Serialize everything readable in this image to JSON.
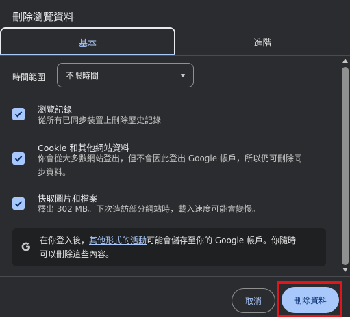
{
  "dialog": {
    "title": "刪除瀏覽資料"
  },
  "tabs": [
    {
      "label": "基本",
      "selected": true
    },
    {
      "label": "進階",
      "selected": false
    }
  ],
  "time_range": {
    "label": "時間範圍",
    "selected": "不限時間"
  },
  "options": [
    {
      "title": "瀏覽記錄",
      "description": "從所有已同步裝置上刪除歷史記錄",
      "checked": true
    },
    {
      "title": "Cookie 和其他網站資料",
      "description_line1": "你會從大多數網站登出，但不會因此登出 Google 帳戶，所以仍可刪除同",
      "description_line2": "步資料。",
      "checked": true
    },
    {
      "title": "快取圖片和檔案",
      "description": "釋出 302 MB。下次造訪部分網站時，載入速度可能會變慢。",
      "checked": true
    }
  ],
  "info": {
    "text_before": "在你登入後，",
    "link": "其他形式的活動",
    "text_after_line1": "可能會儲存至你的 Google 帳戶。你隨時",
    "text_line2": "可以刪除這些內容。",
    "icon": "google-g-icon"
  },
  "footer": {
    "cancel_label": "取消",
    "delete_label": "刪除資料"
  },
  "colors": {
    "accent": "#a8c7fa",
    "highlight": "#e0161c",
    "background": "#2b2c2f"
  }
}
